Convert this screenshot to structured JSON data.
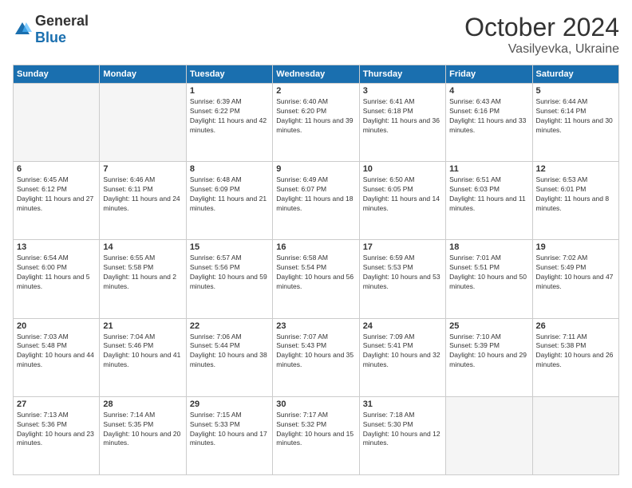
{
  "header": {
    "logo_general": "General",
    "logo_blue": "Blue",
    "month_year": "October 2024",
    "location": "Vasilyevka, Ukraine"
  },
  "weekdays": [
    "Sunday",
    "Monday",
    "Tuesday",
    "Wednesday",
    "Thursday",
    "Friday",
    "Saturday"
  ],
  "weeks": [
    [
      {
        "day": "",
        "sunrise": "",
        "sunset": "",
        "daylight": ""
      },
      {
        "day": "",
        "sunrise": "",
        "sunset": "",
        "daylight": ""
      },
      {
        "day": "1",
        "sunrise": "Sunrise: 6:39 AM",
        "sunset": "Sunset: 6:22 PM",
        "daylight": "Daylight: 11 hours and 42 minutes."
      },
      {
        "day": "2",
        "sunrise": "Sunrise: 6:40 AM",
        "sunset": "Sunset: 6:20 PM",
        "daylight": "Daylight: 11 hours and 39 minutes."
      },
      {
        "day": "3",
        "sunrise": "Sunrise: 6:41 AM",
        "sunset": "Sunset: 6:18 PM",
        "daylight": "Daylight: 11 hours and 36 minutes."
      },
      {
        "day": "4",
        "sunrise": "Sunrise: 6:43 AM",
        "sunset": "Sunset: 6:16 PM",
        "daylight": "Daylight: 11 hours and 33 minutes."
      },
      {
        "day": "5",
        "sunrise": "Sunrise: 6:44 AM",
        "sunset": "Sunset: 6:14 PM",
        "daylight": "Daylight: 11 hours and 30 minutes."
      }
    ],
    [
      {
        "day": "6",
        "sunrise": "Sunrise: 6:45 AM",
        "sunset": "Sunset: 6:12 PM",
        "daylight": "Daylight: 11 hours and 27 minutes."
      },
      {
        "day": "7",
        "sunrise": "Sunrise: 6:46 AM",
        "sunset": "Sunset: 6:11 PM",
        "daylight": "Daylight: 11 hours and 24 minutes."
      },
      {
        "day": "8",
        "sunrise": "Sunrise: 6:48 AM",
        "sunset": "Sunset: 6:09 PM",
        "daylight": "Daylight: 11 hours and 21 minutes."
      },
      {
        "day": "9",
        "sunrise": "Sunrise: 6:49 AM",
        "sunset": "Sunset: 6:07 PM",
        "daylight": "Daylight: 11 hours and 18 minutes."
      },
      {
        "day": "10",
        "sunrise": "Sunrise: 6:50 AM",
        "sunset": "Sunset: 6:05 PM",
        "daylight": "Daylight: 11 hours and 14 minutes."
      },
      {
        "day": "11",
        "sunrise": "Sunrise: 6:51 AM",
        "sunset": "Sunset: 6:03 PM",
        "daylight": "Daylight: 11 hours and 11 minutes."
      },
      {
        "day": "12",
        "sunrise": "Sunrise: 6:53 AM",
        "sunset": "Sunset: 6:01 PM",
        "daylight": "Daylight: 11 hours and 8 minutes."
      }
    ],
    [
      {
        "day": "13",
        "sunrise": "Sunrise: 6:54 AM",
        "sunset": "Sunset: 6:00 PM",
        "daylight": "Daylight: 11 hours and 5 minutes."
      },
      {
        "day": "14",
        "sunrise": "Sunrise: 6:55 AM",
        "sunset": "Sunset: 5:58 PM",
        "daylight": "Daylight: 11 hours and 2 minutes."
      },
      {
        "day": "15",
        "sunrise": "Sunrise: 6:57 AM",
        "sunset": "Sunset: 5:56 PM",
        "daylight": "Daylight: 10 hours and 59 minutes."
      },
      {
        "day": "16",
        "sunrise": "Sunrise: 6:58 AM",
        "sunset": "Sunset: 5:54 PM",
        "daylight": "Daylight: 10 hours and 56 minutes."
      },
      {
        "day": "17",
        "sunrise": "Sunrise: 6:59 AM",
        "sunset": "Sunset: 5:53 PM",
        "daylight": "Daylight: 10 hours and 53 minutes."
      },
      {
        "day": "18",
        "sunrise": "Sunrise: 7:01 AM",
        "sunset": "Sunset: 5:51 PM",
        "daylight": "Daylight: 10 hours and 50 minutes."
      },
      {
        "day": "19",
        "sunrise": "Sunrise: 7:02 AM",
        "sunset": "Sunset: 5:49 PM",
        "daylight": "Daylight: 10 hours and 47 minutes."
      }
    ],
    [
      {
        "day": "20",
        "sunrise": "Sunrise: 7:03 AM",
        "sunset": "Sunset: 5:48 PM",
        "daylight": "Daylight: 10 hours and 44 minutes."
      },
      {
        "day": "21",
        "sunrise": "Sunrise: 7:04 AM",
        "sunset": "Sunset: 5:46 PM",
        "daylight": "Daylight: 10 hours and 41 minutes."
      },
      {
        "day": "22",
        "sunrise": "Sunrise: 7:06 AM",
        "sunset": "Sunset: 5:44 PM",
        "daylight": "Daylight: 10 hours and 38 minutes."
      },
      {
        "day": "23",
        "sunrise": "Sunrise: 7:07 AM",
        "sunset": "Sunset: 5:43 PM",
        "daylight": "Daylight: 10 hours and 35 minutes."
      },
      {
        "day": "24",
        "sunrise": "Sunrise: 7:09 AM",
        "sunset": "Sunset: 5:41 PM",
        "daylight": "Daylight: 10 hours and 32 minutes."
      },
      {
        "day": "25",
        "sunrise": "Sunrise: 7:10 AM",
        "sunset": "Sunset: 5:39 PM",
        "daylight": "Daylight: 10 hours and 29 minutes."
      },
      {
        "day": "26",
        "sunrise": "Sunrise: 7:11 AM",
        "sunset": "Sunset: 5:38 PM",
        "daylight": "Daylight: 10 hours and 26 minutes."
      }
    ],
    [
      {
        "day": "27",
        "sunrise": "Sunrise: 7:13 AM",
        "sunset": "Sunset: 5:36 PM",
        "daylight": "Daylight: 10 hours and 23 minutes."
      },
      {
        "day": "28",
        "sunrise": "Sunrise: 7:14 AM",
        "sunset": "Sunset: 5:35 PM",
        "daylight": "Daylight: 10 hours and 20 minutes."
      },
      {
        "day": "29",
        "sunrise": "Sunrise: 7:15 AM",
        "sunset": "Sunset: 5:33 PM",
        "daylight": "Daylight: 10 hours and 17 minutes."
      },
      {
        "day": "30",
        "sunrise": "Sunrise: 7:17 AM",
        "sunset": "Sunset: 5:32 PM",
        "daylight": "Daylight: 10 hours and 15 minutes."
      },
      {
        "day": "31",
        "sunrise": "Sunrise: 7:18 AM",
        "sunset": "Sunset: 5:30 PM",
        "daylight": "Daylight: 10 hours and 12 minutes."
      },
      {
        "day": "",
        "sunrise": "",
        "sunset": "",
        "daylight": ""
      },
      {
        "day": "",
        "sunrise": "",
        "sunset": "",
        "daylight": ""
      }
    ]
  ]
}
